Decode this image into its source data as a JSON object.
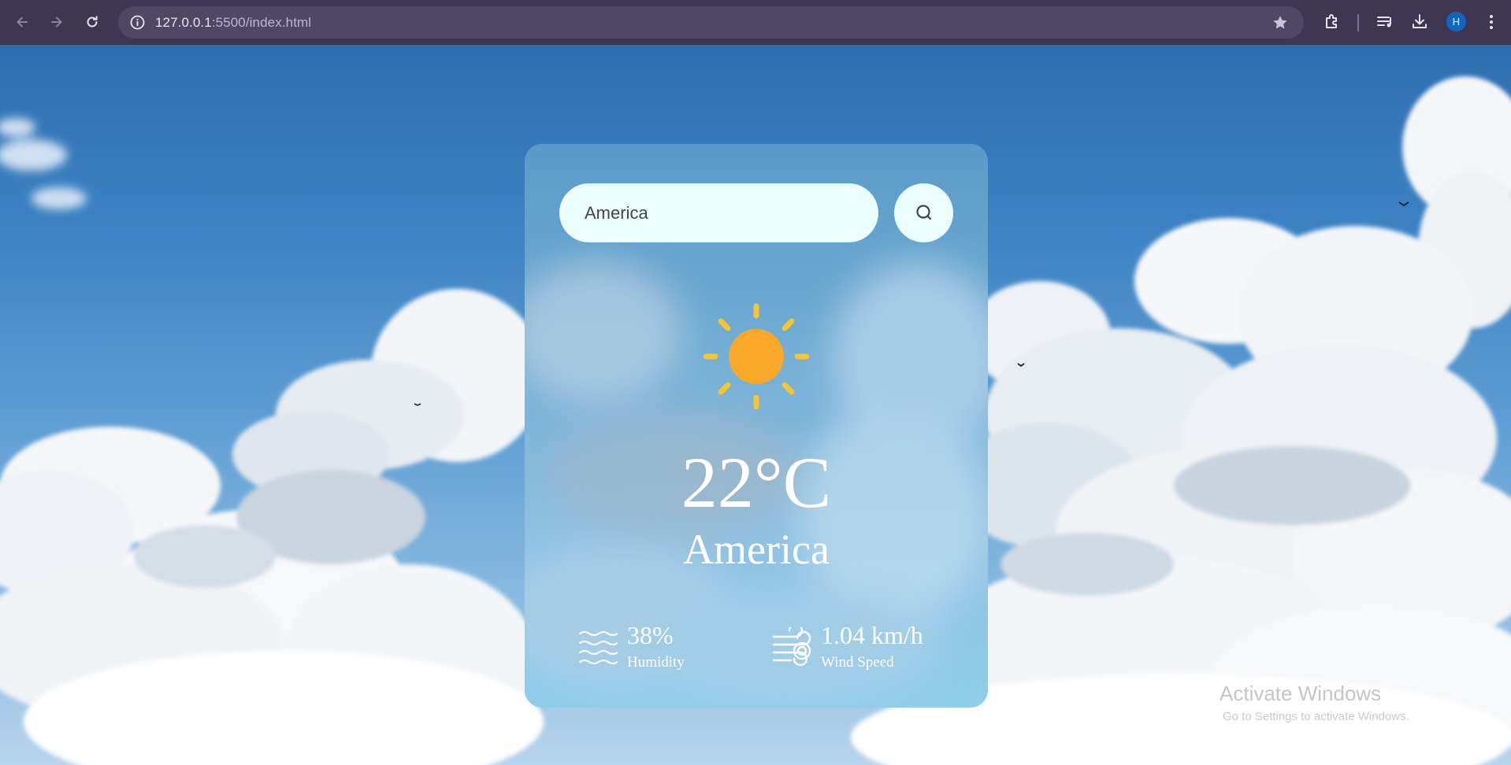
{
  "browser": {
    "url_host": "127.0.0.1",
    "url_path": ":5500/index.html",
    "profile_initial": "H",
    "icons": [
      "back-arrow-icon",
      "forward-arrow-icon",
      "reload-icon",
      "site-info-icon",
      "bookmark-star-icon",
      "extensions-icon",
      "media-control-icon",
      "download-icon",
      "more-menu-icon"
    ]
  },
  "search": {
    "value": "America"
  },
  "weather": {
    "icon": "sun-icon",
    "temperature": "22°C",
    "city": "America",
    "humidity_value": "38%",
    "humidity_label": "Humidity",
    "wind_value": "1.04 km/h",
    "wind_label": "Wind Speed"
  },
  "os": {
    "watermark_title": "Activate Windows",
    "watermark_sub": "Go to Settings to activate Windows."
  },
  "colors": {
    "chrome_bg": "#3f3752",
    "input_bg": "#ebfefe",
    "sun": "#f9a82a",
    "sun_rays": "#f6c531"
  }
}
